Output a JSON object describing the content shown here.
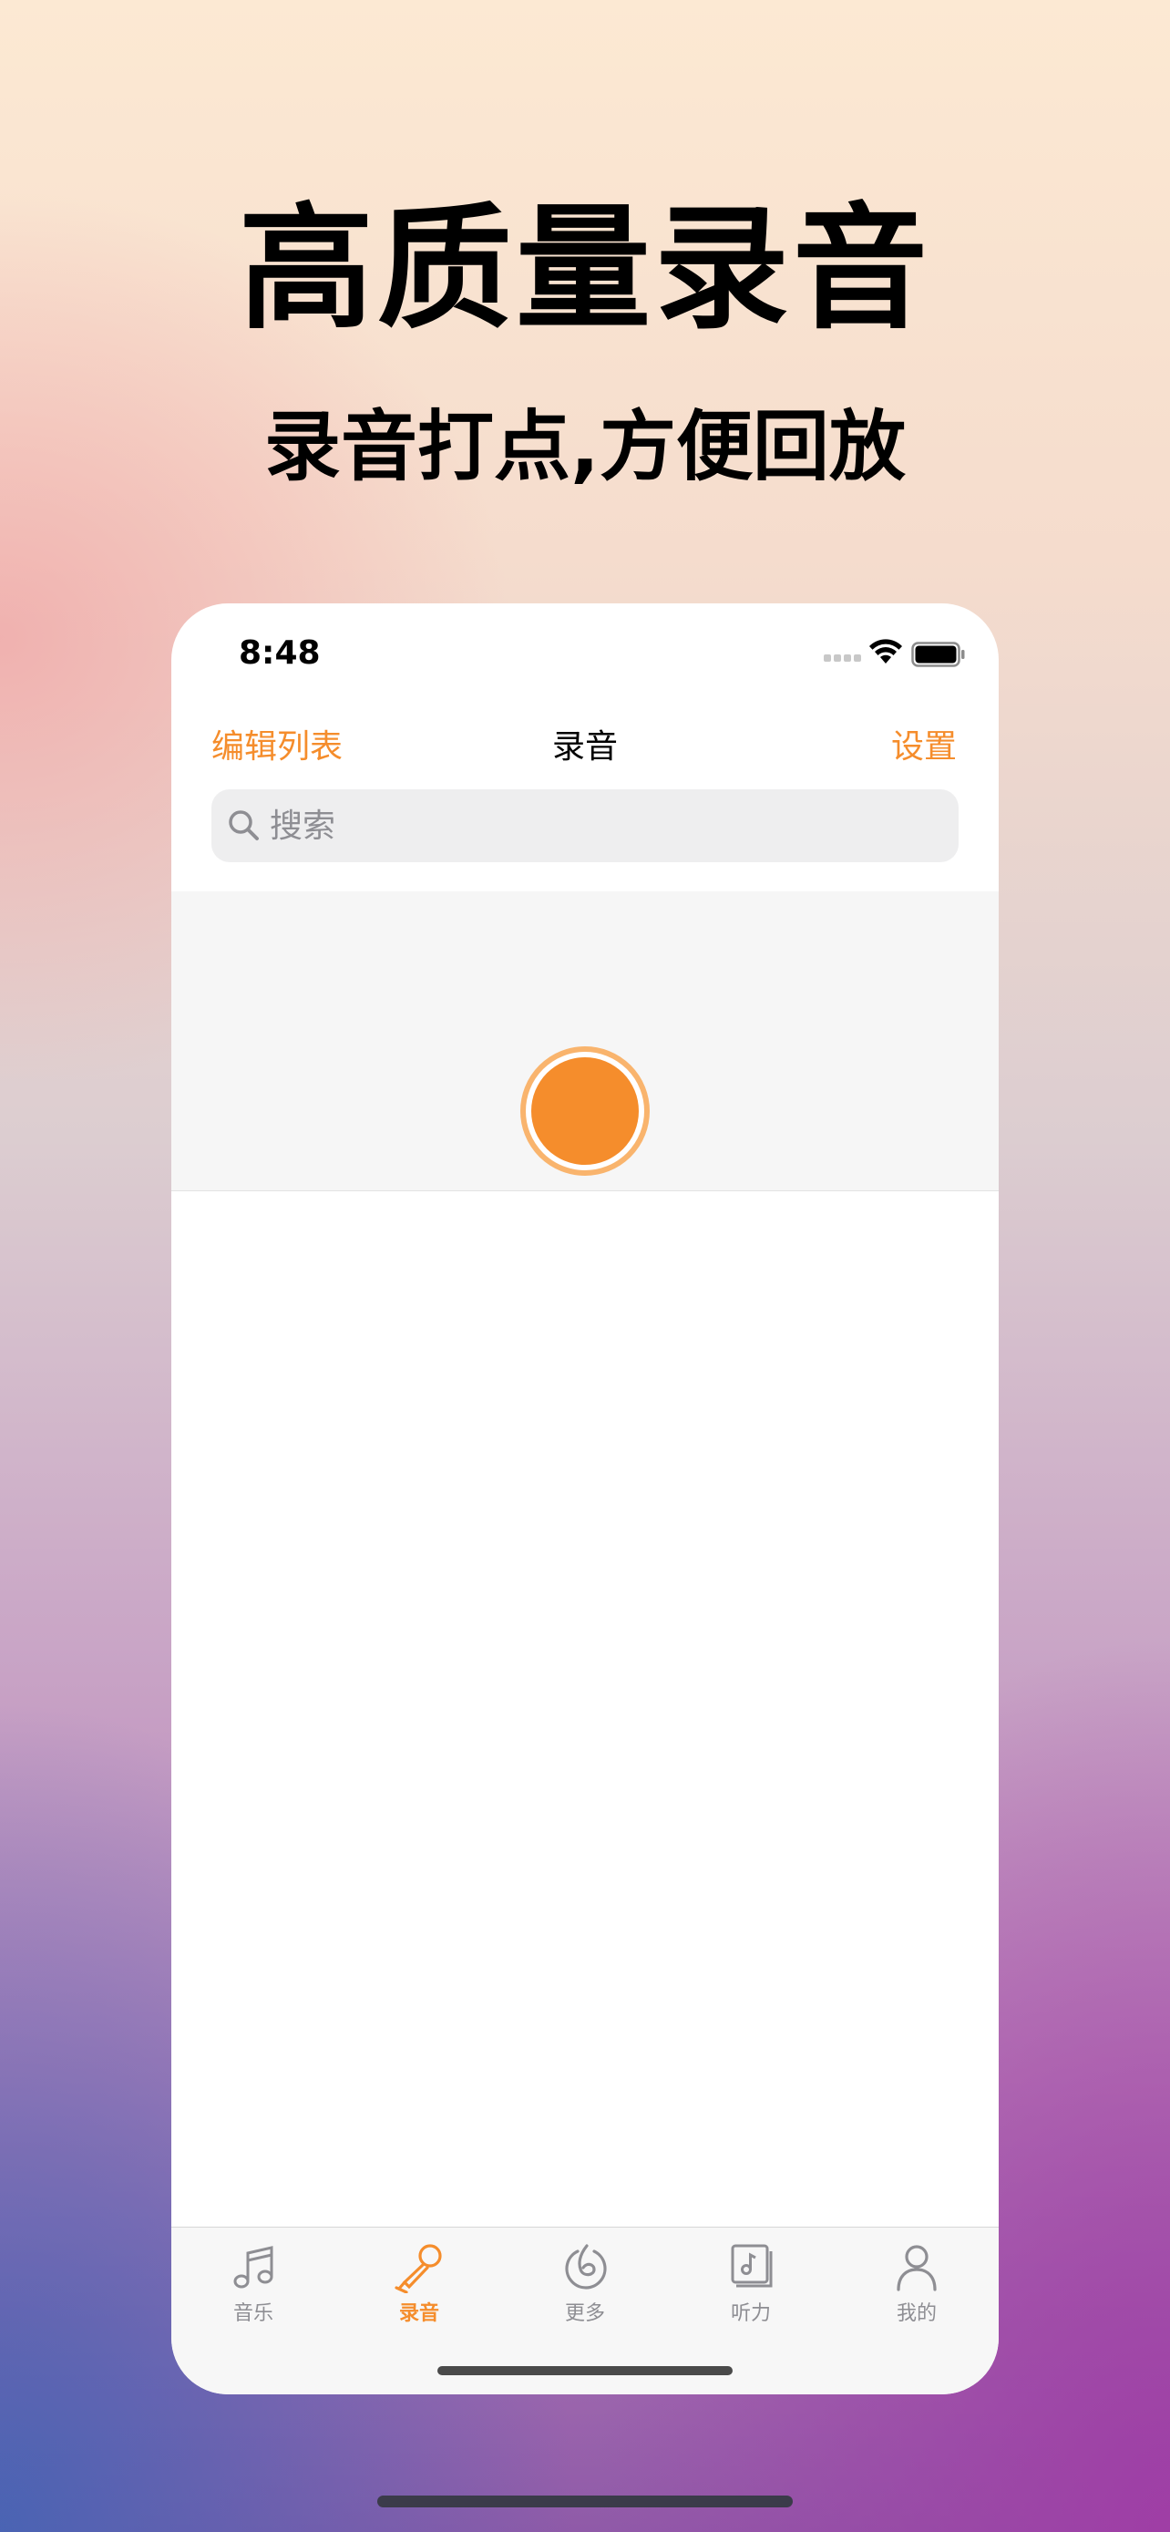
{
  "promo": {
    "headline": "高质量录音",
    "subheadline": "录音打点,方便回放"
  },
  "status_bar": {
    "time": "8:48",
    "icons": [
      "signal-icon",
      "wifi-icon",
      "battery-icon"
    ]
  },
  "nav": {
    "left_label": "编辑列表",
    "title": "录音",
    "right_label": "设置"
  },
  "search": {
    "placeholder": "搜索",
    "value": ""
  },
  "recorder": {
    "icon": "record-button"
  },
  "tab_bar": {
    "active_index": 1,
    "items": [
      {
        "label": "音乐",
        "icon": "music-note-icon"
      },
      {
        "label": "录音",
        "icon": "microphone-icon"
      },
      {
        "label": "更多",
        "icon": "more-icon"
      },
      {
        "label": "听力",
        "icon": "listening-icon"
      },
      {
        "label": "我的",
        "icon": "person-icon"
      }
    ]
  },
  "colors": {
    "accent": "#f58d2c",
    "accent_light": "#f9b46d",
    "tab_inactive": "#8e8e93"
  }
}
